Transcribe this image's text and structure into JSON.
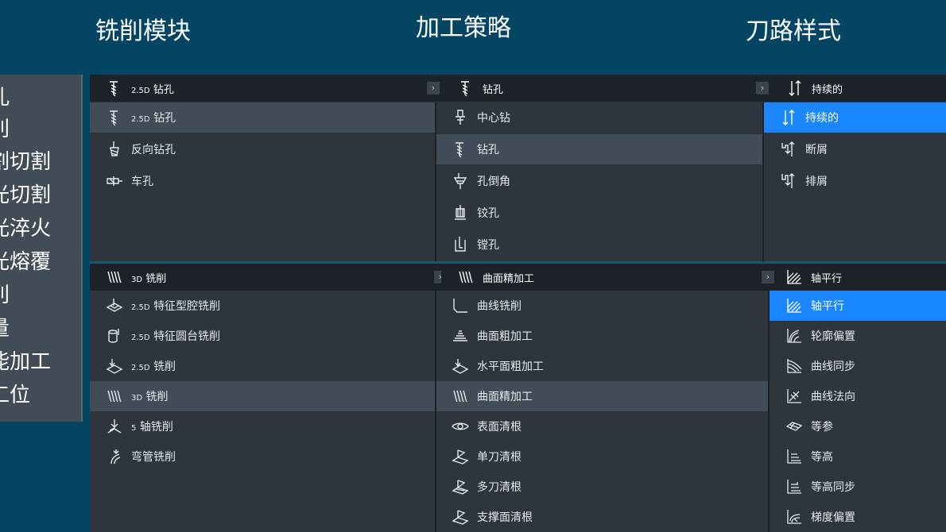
{
  "headers": {
    "milling_module": "铣削模块",
    "machining_strategy": "加工策略",
    "toolpath_style": "刀路样式"
  },
  "left_panel": {
    "items": [
      "孔",
      "削",
      "割切割",
      "光切割",
      "光淬火",
      "光熔覆",
      "削",
      "量",
      "能加工",
      "工位"
    ]
  },
  "top": {
    "col1": {
      "header_prefix": "2.5D",
      "header_label": "钻孔",
      "rows": [
        {
          "prefix": "2.5D",
          "label": "钻孔",
          "icon": "drill-icon"
        },
        {
          "prefix": "",
          "label": "反向钻孔",
          "icon": "back-drill-icon"
        },
        {
          "prefix": "",
          "label": "车孔",
          "icon": "bore-turn-icon"
        }
      ]
    },
    "col2": {
      "header_label": "钻孔",
      "rows": [
        {
          "label": "中心钻",
          "icon": "center-drill-icon"
        },
        {
          "label": "钻孔",
          "icon": "drill-icon"
        },
        {
          "label": "孔倒角",
          "icon": "chamfer-icon"
        },
        {
          "label": "铰孔",
          "icon": "ream-icon"
        },
        {
          "label": "镗孔",
          "icon": "boring-icon"
        }
      ]
    },
    "col3": {
      "header_label": "持续的",
      "rows": [
        {
          "label": "持续的",
          "icon": "continuous-icon"
        },
        {
          "label": "断屑",
          "icon": "chip-break-icon"
        },
        {
          "label": "排屑",
          "icon": "chip-remove-icon"
        }
      ]
    }
  },
  "bottom": {
    "col1": {
      "header_prefix": "3D",
      "header_label": "铣削",
      "rows": [
        {
          "prefix": "2.5D",
          "label": "特征型腔铣削",
          "icon": "pocket-icon"
        },
        {
          "prefix": "2.5D",
          "label": "特征圆台铣削",
          "icon": "boss-icon"
        },
        {
          "prefix": "2.5D",
          "label": "铣削",
          "icon": "mill-25d-icon"
        },
        {
          "prefix": "3D",
          "label": "铣削",
          "icon": "mill-3d-icon"
        },
        {
          "prefix": "5",
          "label": "轴铣削",
          "icon": "five-axis-icon"
        },
        {
          "prefix": "",
          "label": "弯管铣削",
          "icon": "bent-pipe-icon"
        }
      ]
    },
    "col2": {
      "header_label": "曲面精加工",
      "rows": [
        {
          "label": "曲线铣削",
          "icon": "curve-mill-icon"
        },
        {
          "label": "曲面粗加工",
          "icon": "surface-rough-icon"
        },
        {
          "label": "水平面粗加工",
          "icon": "flat-rough-icon"
        },
        {
          "label": "曲面精加工",
          "icon": "surface-finish-icon"
        },
        {
          "label": "表面清根",
          "icon": "surface-clean-icon"
        },
        {
          "label": "单刀清根",
          "icon": "single-clean-icon"
        },
        {
          "label": "多刀清根",
          "icon": "multi-clean-icon"
        },
        {
          "label": "支撑面清根",
          "icon": "support-clean-icon"
        }
      ]
    },
    "col3": {
      "header_label": "轴平行",
      "rows": [
        {
          "label": "轴平行",
          "icon": "axis-parallel-icon"
        },
        {
          "label": "轮廓偏置",
          "icon": "contour-offset-icon"
        },
        {
          "label": "曲线同步",
          "icon": "curve-sync-icon"
        },
        {
          "label": "曲线法向",
          "icon": "curve-normal-icon"
        },
        {
          "label": "等参",
          "icon": "isoparam-icon"
        },
        {
          "label": "等高",
          "icon": "z-level-icon"
        },
        {
          "label": "等高同步",
          "icon": "z-level-sync-icon"
        },
        {
          "label": "梯度偏置",
          "icon": "gradient-offset-icon"
        }
      ]
    }
  },
  "chevron": "›",
  "colors": {
    "background": "#034562",
    "panel": "#2e353d",
    "header_row": "#1c2228",
    "selected": "#414c57",
    "highlight": "#1a86ff"
  }
}
